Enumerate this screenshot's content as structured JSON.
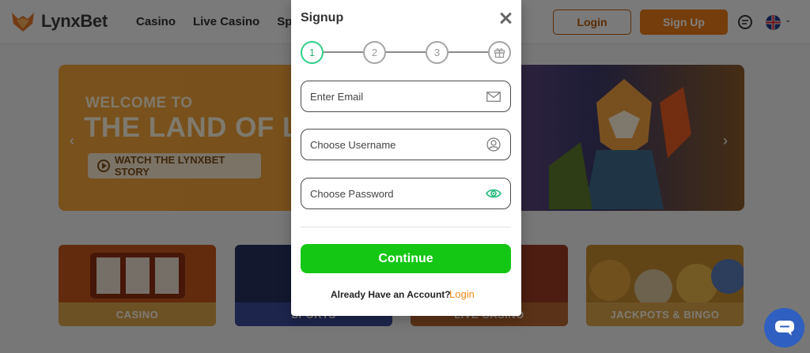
{
  "header": {
    "brand": "LynxBet",
    "nav": [
      "Casino",
      "Live Casino",
      "Spor"
    ],
    "login_label": "Login",
    "signup_label": "Sign Up"
  },
  "hero": {
    "subtitle": "WELCOME TO",
    "title": "THE LAND OF LY",
    "cta": "WATCH THE LYNXBET STORY"
  },
  "cards": [
    {
      "label": "CASINO",
      "color": "#c4571b"
    },
    {
      "label": "SPORTS",
      "color": "#26305e"
    },
    {
      "label": "LIVE CASINO",
      "color": "#9a3b22"
    },
    {
      "label": "JACKPOTS & BINGO",
      "color": "#c58a2f"
    }
  ],
  "modal": {
    "title": "Signup",
    "steps": [
      "1",
      "2",
      "3",
      "gift-icon"
    ],
    "active_step": 1,
    "email_placeholder": "Enter Email",
    "username_placeholder": "Choose Username",
    "password_placeholder": "Choose Password",
    "continue_label": "Continue",
    "already_text": "Already Have an Account?",
    "login_link": "Login"
  },
  "colors": {
    "accent_orange": "#e87a16",
    "continue_green": "#14c714",
    "active_step": "#2fcf8a",
    "link_orange": "#f08a1a",
    "chat_blue": "#2f5fc0"
  }
}
